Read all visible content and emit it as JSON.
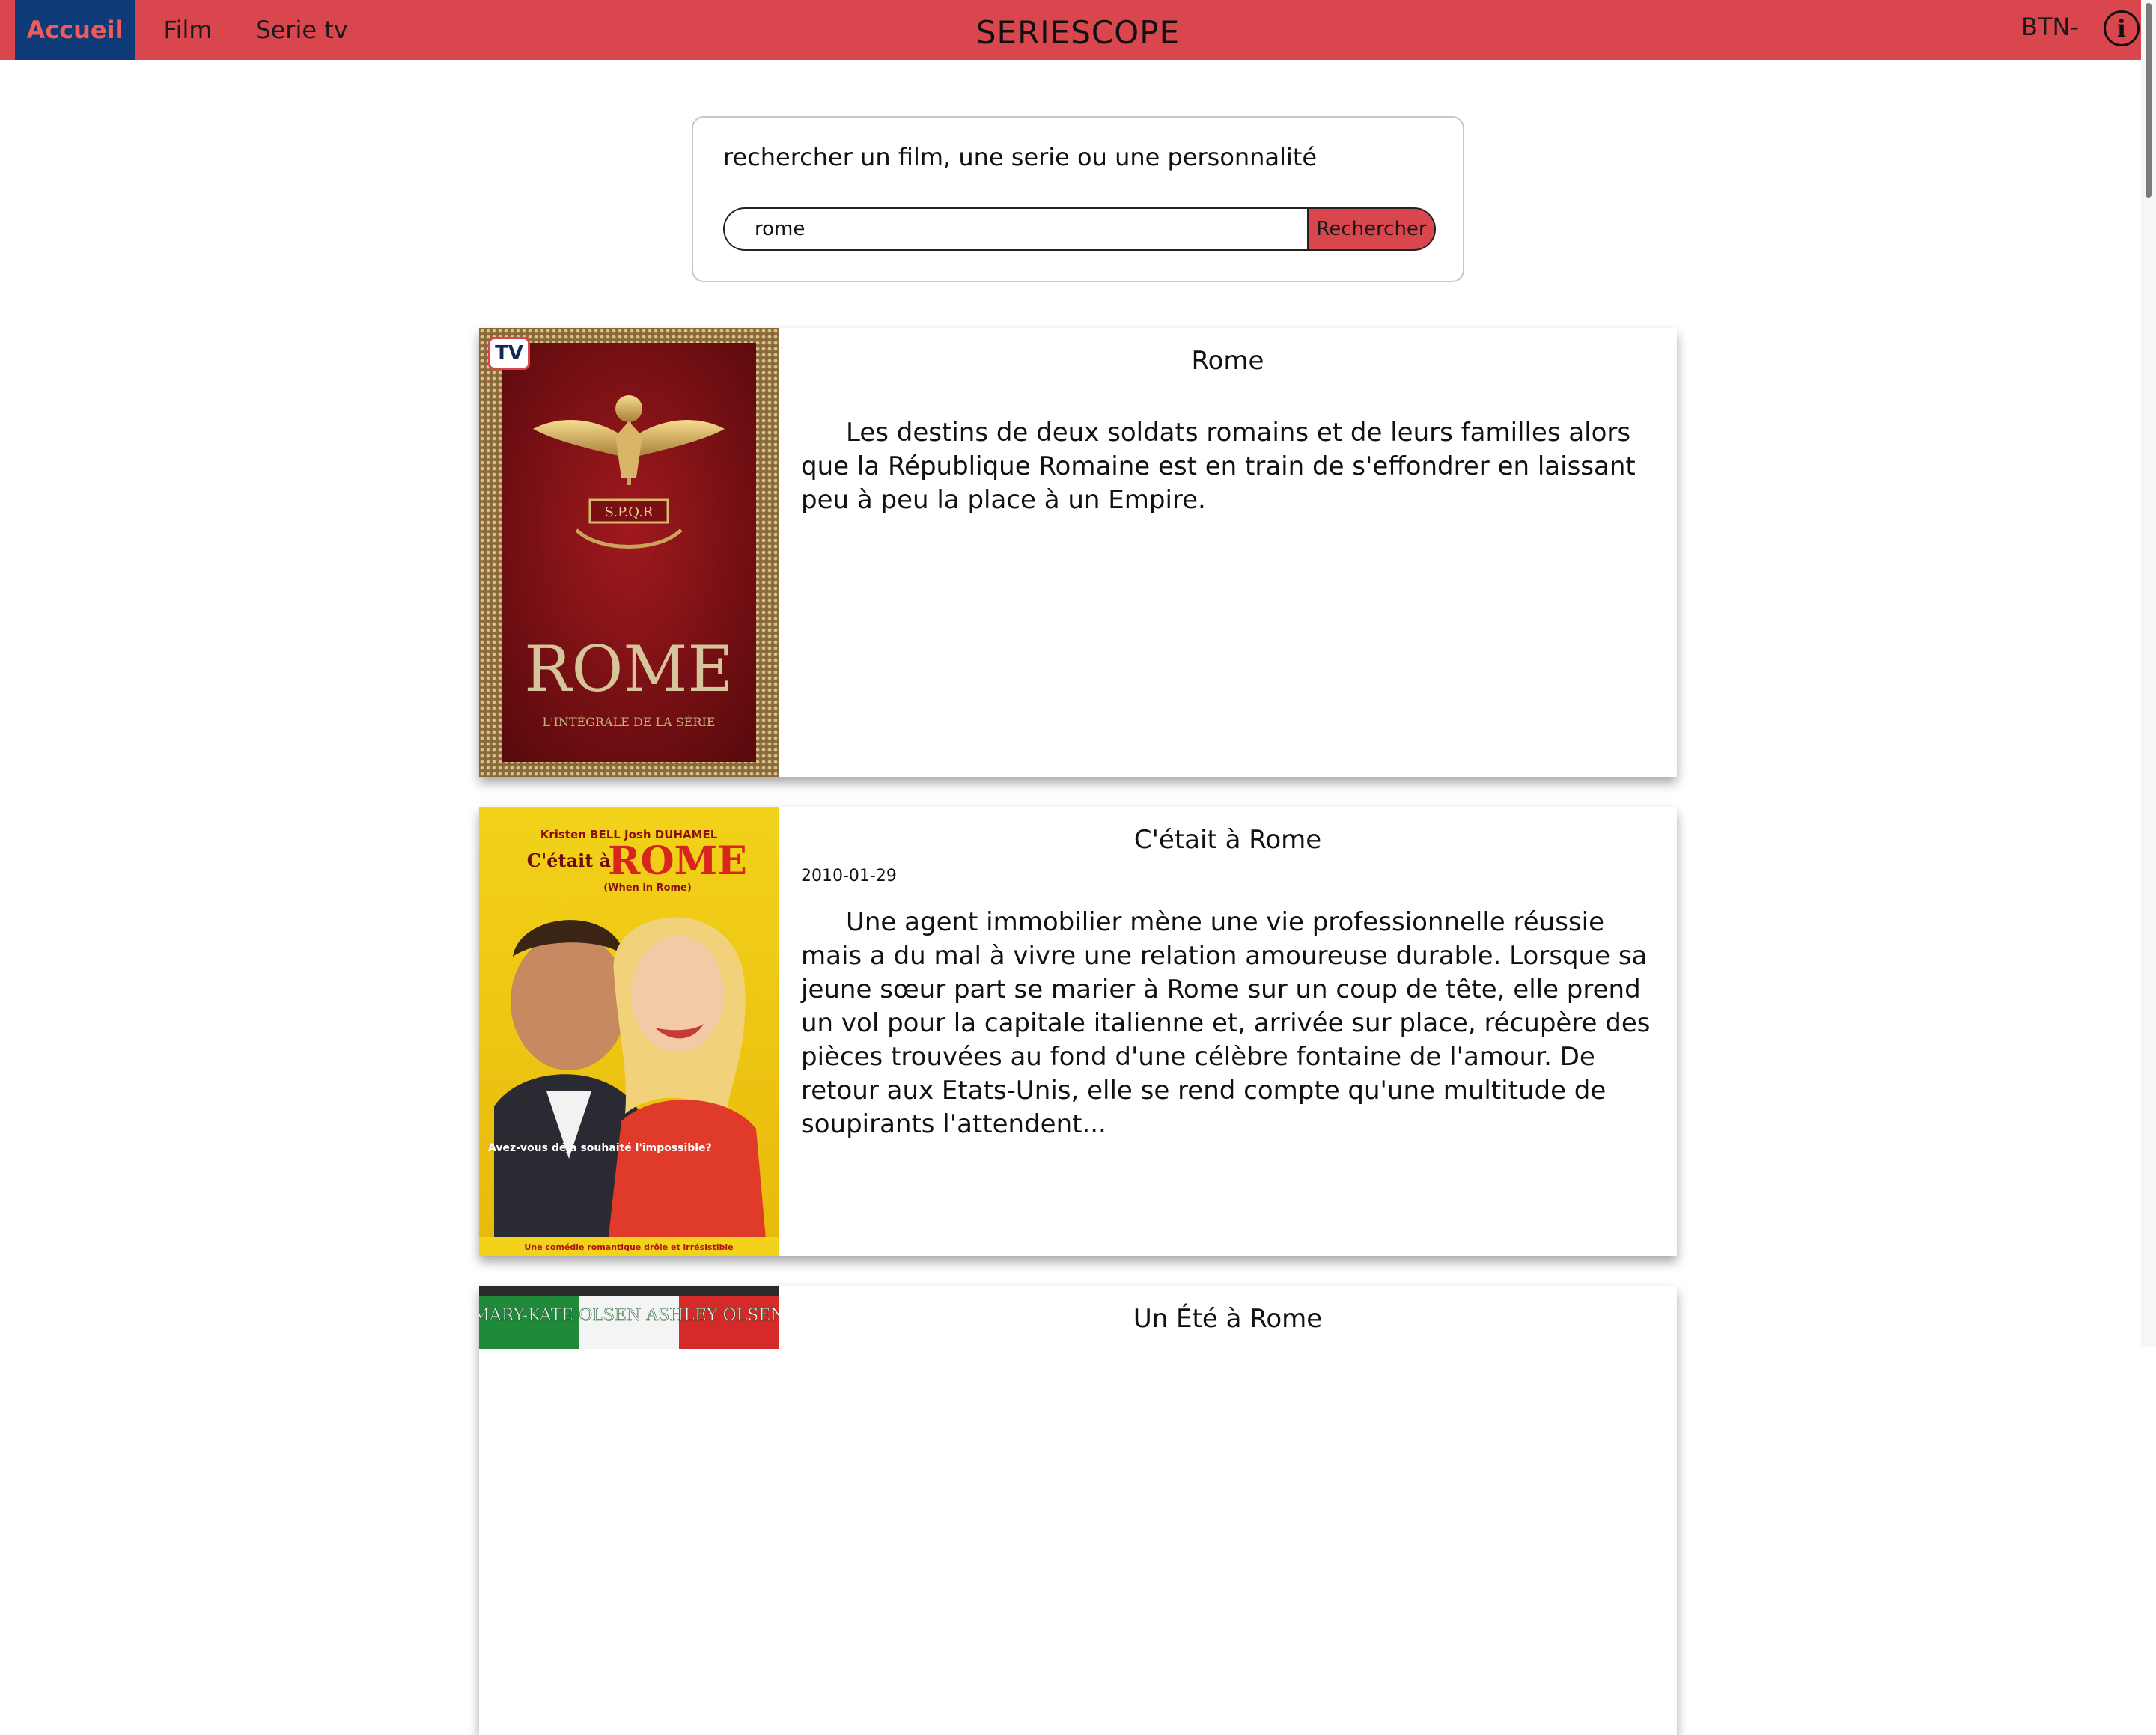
{
  "nav": {
    "items": [
      {
        "label": "Accueil"
      },
      {
        "label": "Film"
      },
      {
        "label": "Serie tv"
      }
    ],
    "brand": "SERIESCOPE",
    "btn_label": "BTN-",
    "info_icon": "i"
  },
  "search": {
    "title": "rechercher un film, une serie ou une personnalité",
    "value": "rome",
    "button_label": "Rechercher"
  },
  "results": [
    {
      "badge": "TV",
      "title": "Rome",
      "date": "",
      "description": "Les destins de deux soldats romains et de leurs familles alors que la République Romaine est en train de s'effondrer en laissant peu à peu la place à un Empire.",
      "poster": {
        "title": "ROME",
        "subtitle": "L'INTÉGRALE DE LA SÉRIE",
        "seal": "S.P.Q.R"
      }
    },
    {
      "badge": "",
      "title": "C'était à Rome",
      "date": "2010-01-29",
      "description": "Une agent immobilier mène une vie professionnelle réussie mais a du mal à vivre une relation amoureuse durable. Lorsque sa jeune sœur part se marier à Rome sur un coup de tête, elle prend un vol pour la capitale italienne et, arrivée sur place, récupère des pièces trouvées au fond d'une célèbre fontaine de l'amour. De retour aux Etats-Unis, elle se rend compte qu'une multitude de soupirants l'attendent...",
      "poster": {
        "actors": "Kristen BELL   Josh DUHAMEL",
        "title_small": "C'était à",
        "title": "ROME",
        "subtitle": "(When in Rome)",
        "tagline": "Avez-vous déjà souhaité l'impossible?",
        "footer": "Une comédie romantique drôle et irrésistible"
      }
    },
    {
      "badge": "",
      "title": "Un Été à Rome",
      "date": "",
      "description": "",
      "poster": {
        "actors": "MARY-KATE OLSEN   ASHLEY OLSEN"
      }
    }
  ],
  "colors": {
    "accent": "#d9464d",
    "nav_active_bg": "#0e3a78",
    "nav_active_text": "#f15a5a"
  }
}
